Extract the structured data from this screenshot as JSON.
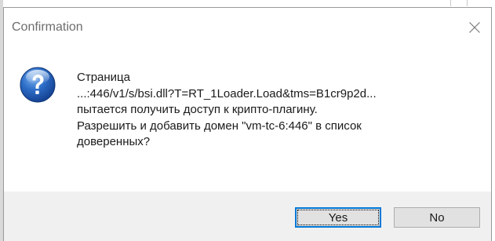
{
  "window": {
    "title": "Confirmation",
    "close_icon": "close-icon"
  },
  "message": {
    "icon": "question-icon",
    "lines": [
      "Страница",
      "...:446/v1/s/bsi.dll?T=RT_1Loader.Load&tms=B1cr9p2d...",
      "пытается получить доступ к крипто-плагину.",
      "Разрешить и добавить домен \"vm-tc-6:446\" в список",
      "доверенных?"
    ]
  },
  "buttons": {
    "yes_label": "Yes",
    "no_label": "No"
  },
  "colors": {
    "accent": "#0078d7",
    "icon_blue": "#1f5fb5",
    "footer_bg": "#f0f0f0",
    "button_bg": "#e1e1e1",
    "title_text": "#6d6d6d"
  }
}
